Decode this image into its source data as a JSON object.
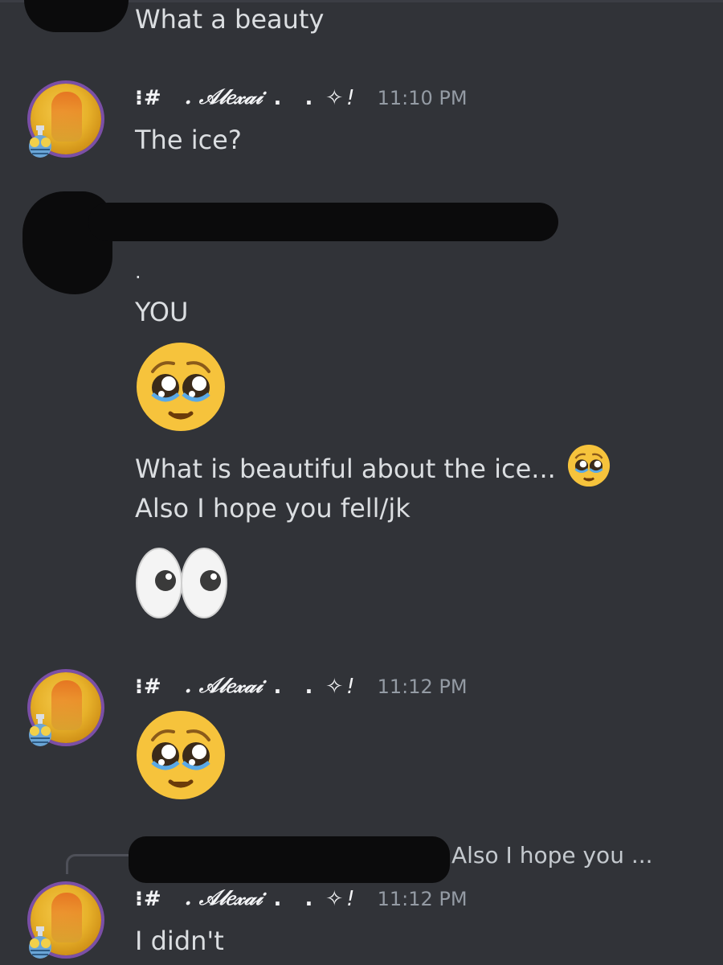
{
  "messages": {
    "m1_text": "What a beauty",
    "author": {
      "prefix": "⁝#",
      "name": ". 𝒜𝓁𝑒𝓍𝒶𝒾",
      "dots": ". .",
      "diamond": "✧",
      "slash": "!"
    },
    "m2_time": "11:10 PM",
    "m2_text": "The ice?",
    "m3_dot": ".",
    "m3_you": "YOU",
    "m3_pleading_emoji": "🥺",
    "m3_line1": "What is beautiful about the ice...",
    "m3_line2": "Also I hope you fell/jk",
    "m3_eyes_emoji": "👀",
    "m4_time": "11:12 PM",
    "m4_pleading_emoji": "🥺",
    "reply_preview": "Also I hope you ...",
    "m5_time": "11:12 PM",
    "m5_text": "I didn't"
  },
  "icons": {
    "avatar": "avatar-image",
    "pleading": "pleading-face-icon",
    "eyes": "eyes-icon"
  },
  "colors": {
    "background": "#313338",
    "text": "#dbdee1",
    "timestamp": "#949ba4",
    "avatar_ring": "#7b4fa6",
    "emoji_yellow": "#f6c33c"
  }
}
